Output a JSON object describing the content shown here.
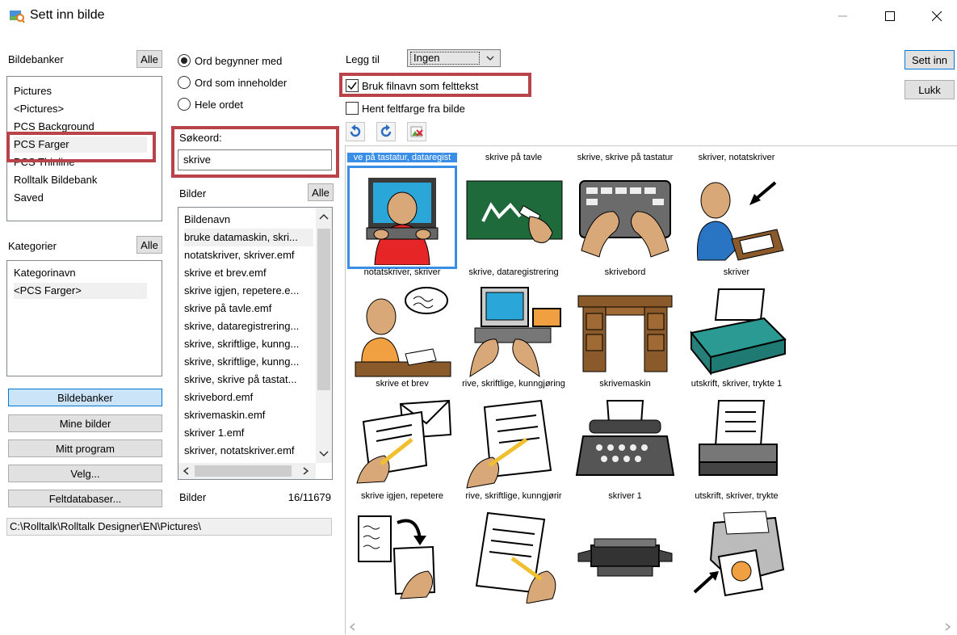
{
  "window": {
    "title": "Sett inn bilde"
  },
  "banks": {
    "label": "Bildebanker",
    "all_button": "Alle",
    "items": [
      "Pictures",
      "<Pictures>",
      "PCS Background",
      "PCS Farger",
      "PCS Thinline",
      "Rolltalk Bildebank",
      "Saved"
    ],
    "selected": "PCS Farger"
  },
  "categories": {
    "label": "Kategorier",
    "all_button": "Alle",
    "items": [
      "Kategorinavn",
      "<PCS Farger>"
    ]
  },
  "nav_buttons": [
    "Bildebanker",
    "Mine bilder",
    "Mitt program",
    "Velg...",
    "Feltdatabaser..."
  ],
  "path": "C:\\Rolltalk\\Rolltalk Designer\\EN\\Pictures\\",
  "search": {
    "radio_begins": "Ord begynner med",
    "radio_contains": "Ord som inneholder",
    "radio_whole": "Hele ordet",
    "keyword_label": "Søkeord:",
    "keyword_value": "skrive"
  },
  "pictures": {
    "label": "Bilder",
    "all_button": "Alle",
    "column_header": "Bildenavn",
    "names": [
      "bruke datamaskin, skri...",
      "notatskriver, skriver.emf",
      "skrive et brev.emf",
      "skrive igjen, repetere.e...",
      "skrive på tavle.emf",
      "skrive, dataregistrering...",
      "skrive, skriftlige, kunng...",
      "skrive, skriftlige, kunng...",
      "skrive, skrive på tastat...",
      "skrivebord.emf",
      "skrivemaskin.emf",
      "skriver 1.emf",
      "skriver, notatskriver.emf"
    ],
    "footer_label": "Bilder",
    "count": "16/11679"
  },
  "options": {
    "add_label": "Legg til",
    "add_value": "Ingen",
    "use_filename": "Bruk filnavn som felttekst",
    "use_filename_checked": true,
    "fetch_color": "Hent feltfarge fra bilde",
    "fetch_color_checked": false
  },
  "actions": {
    "insert": "Sett inn",
    "close": "Lukk"
  },
  "grid": [
    {
      "caption": "ve på tastatur, dataregist",
      "icon": "computer-user-icon"
    },
    {
      "caption": "skrive på tavle",
      "icon": "blackboard-writing-icon"
    },
    {
      "caption": "skrive, skrive på tastatur",
      "icon": "typing-hands-icon"
    },
    {
      "caption": "skriver, notatskriver",
      "icon": "note-writer-icon"
    },
    {
      "caption": "notatskriver, skriver",
      "icon": "person-thinking-writing-icon"
    },
    {
      "caption": "skrive, dataregistrering",
      "icon": "data-entry-icon"
    },
    {
      "caption": "skrivebord",
      "icon": "desk-icon"
    },
    {
      "caption": "skriver",
      "icon": "printer-icon"
    },
    {
      "caption": "skrive et brev",
      "icon": "write-letter-icon"
    },
    {
      "caption": "rive, skriftlige, kunngjøring",
      "icon": "write-paper-icon"
    },
    {
      "caption": "skrivemaskin",
      "icon": "typewriter-icon"
    },
    {
      "caption": "utskrift, skriver, trykte 1",
      "icon": "print-out-icon"
    },
    {
      "caption": "skrive igjen, repetere",
      "icon": "rewrite-icon"
    },
    {
      "caption": "rive, skriftlige, kunngjørir",
      "icon": "write-document-icon"
    },
    {
      "caption": "skriver 1",
      "icon": "flat-printer-icon"
    },
    {
      "caption": "utskrift, skriver, trykte",
      "icon": "photo-printer-icon"
    }
  ],
  "colors": {
    "highlight": "#b8434a",
    "selection": "#3a8ee6",
    "active_button": "#cce4f7"
  }
}
